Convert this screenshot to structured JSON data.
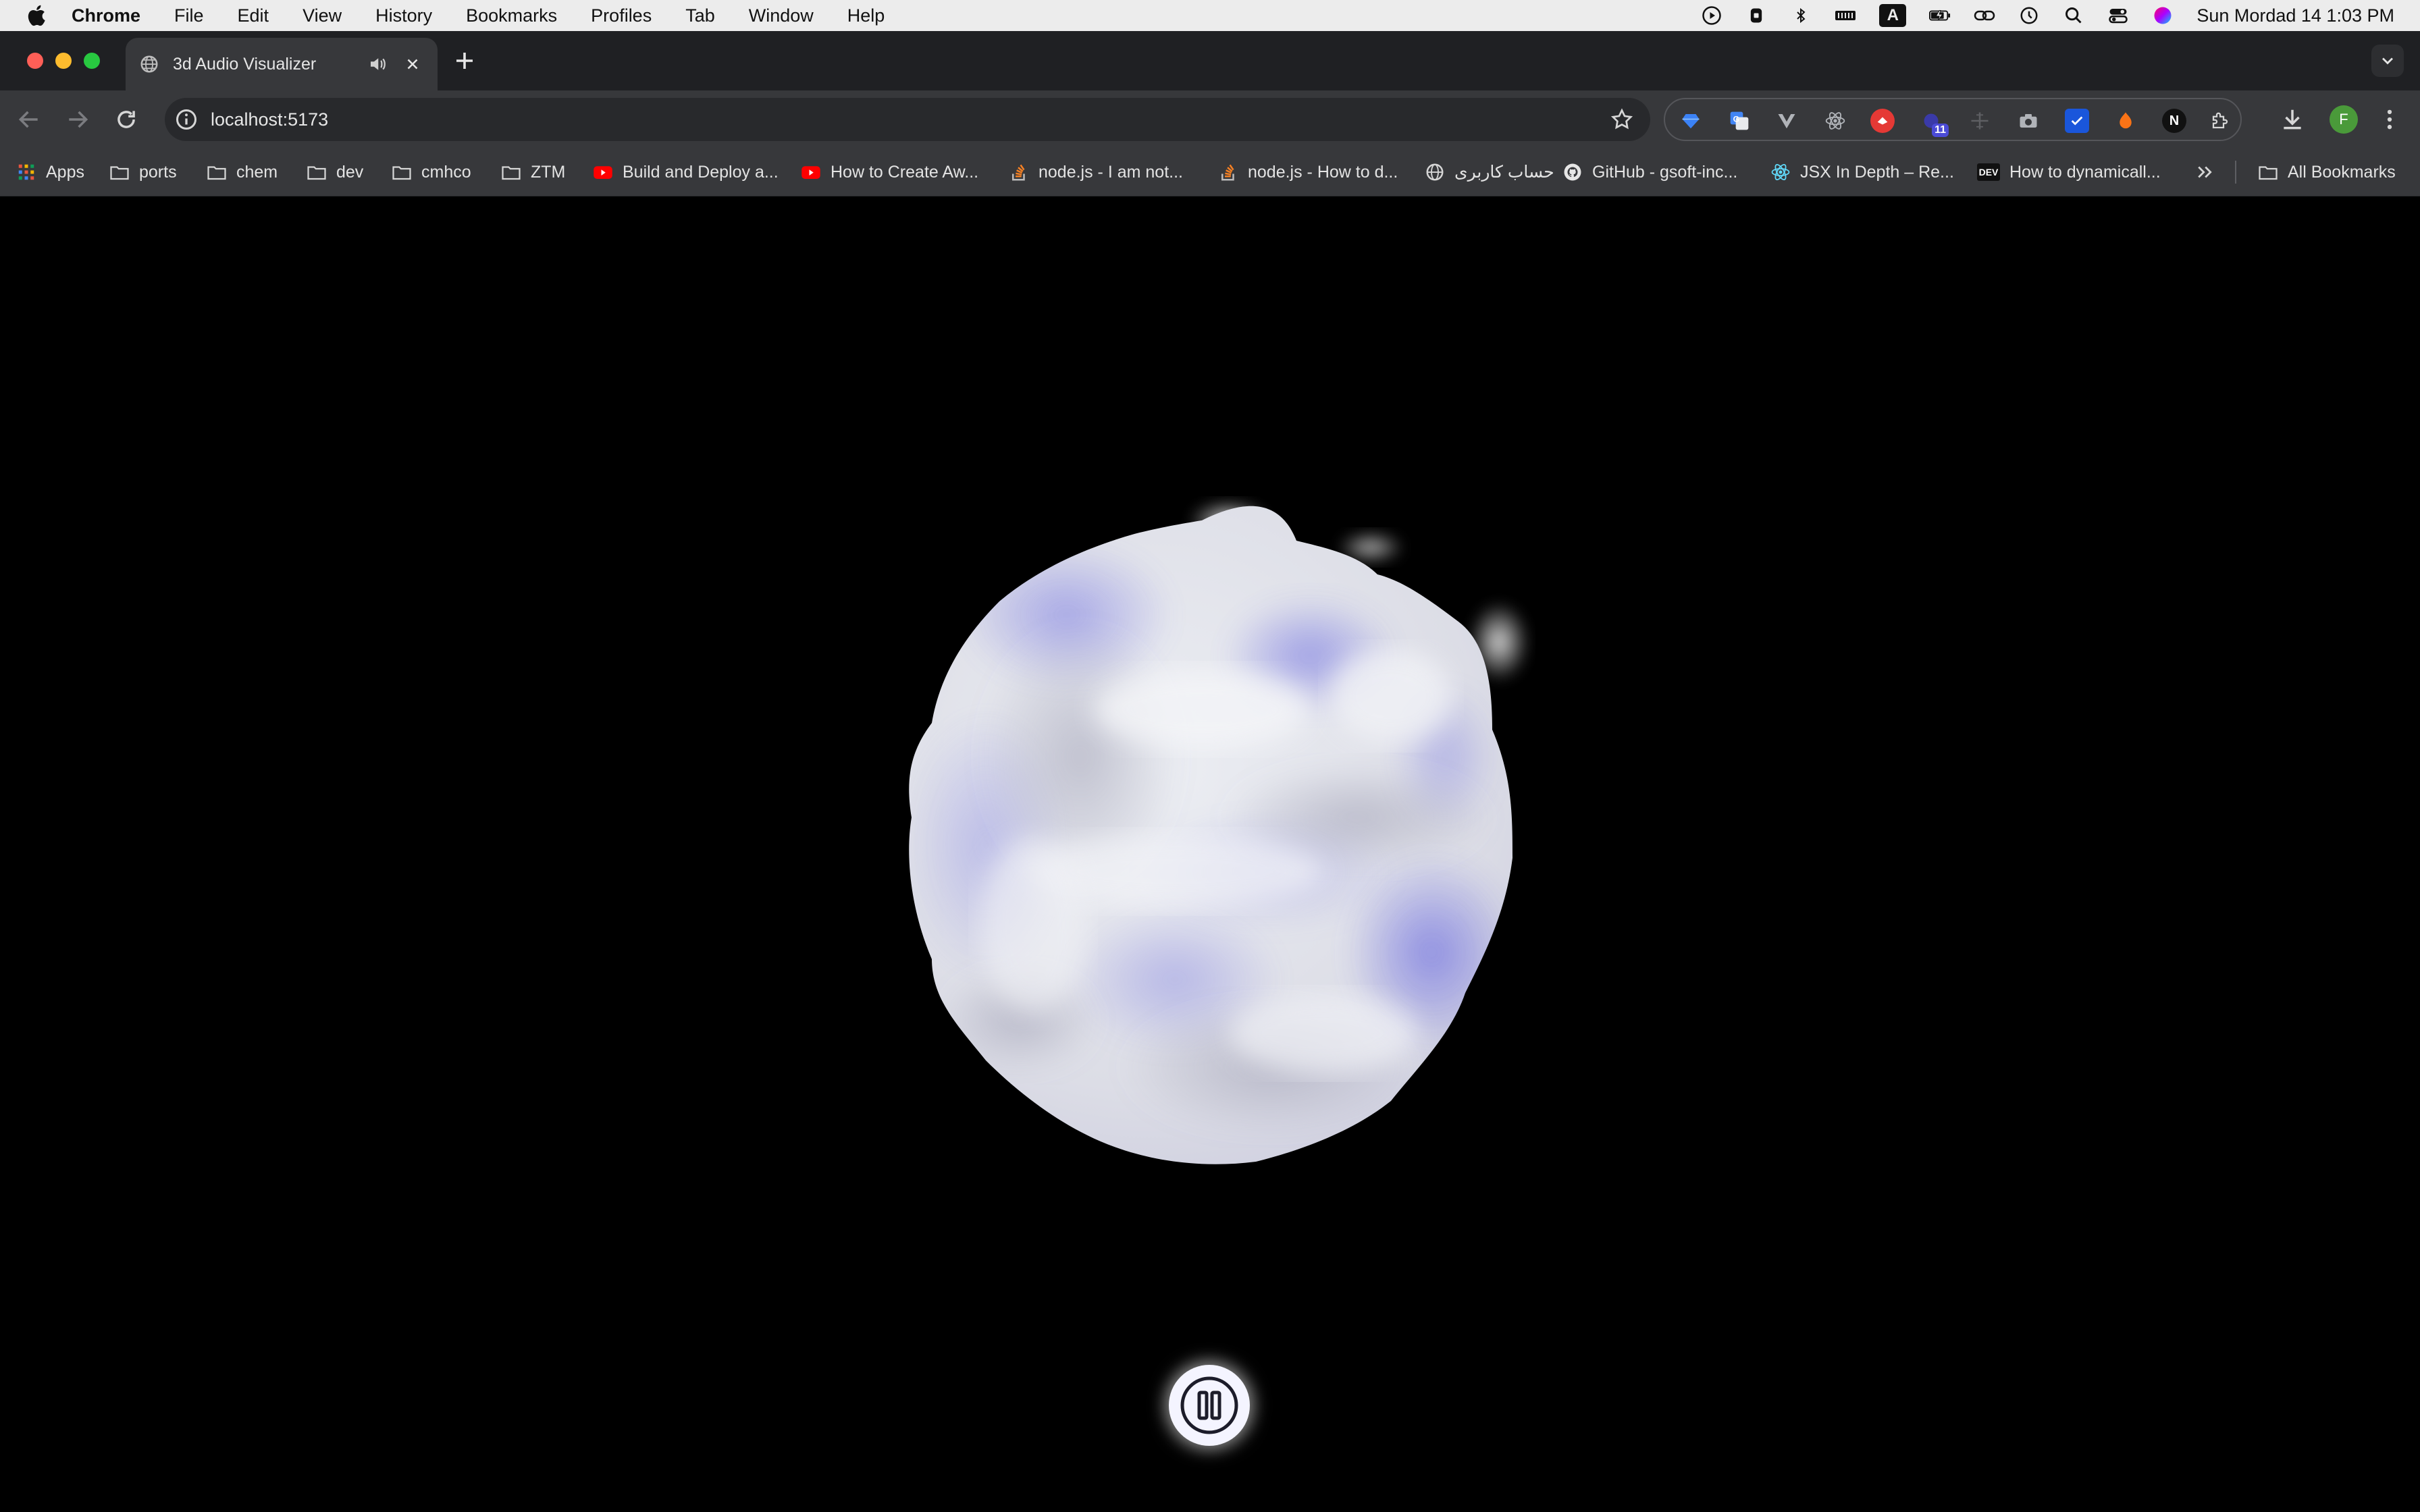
{
  "menubar": {
    "app_name": "Chrome",
    "items": [
      "File",
      "Edit",
      "View",
      "History",
      "Bookmarks",
      "Profiles",
      "Tab",
      "Window",
      "Help"
    ],
    "clock": "Sun Mordad 14  1:03 PM",
    "status_icons": [
      "play-circle-icon",
      "lock-icon",
      "bluetooth-icon",
      "battery-bars-icon",
      "input-source-icon",
      "battery-charging-icon",
      "link-icon",
      "clock-icon",
      "search-icon",
      "control-center-icon",
      "siri-icon"
    ],
    "input_source_label": "A"
  },
  "tab": {
    "title": "3d Audio Visualizer",
    "favicon": "globe-icon",
    "audio_icon": "speaker-icon",
    "close_icon": "close-icon"
  },
  "address_bar": {
    "url": "localhost:5173"
  },
  "extensions": {
    "badge_count": "11",
    "notion_letter": "N"
  },
  "profile": {
    "initial": "F",
    "color": "#4a9a3a"
  },
  "bookmarks": {
    "items": [
      {
        "label": "Apps",
        "icon": "apps-grid-icon"
      },
      {
        "label": "ports",
        "icon": "folder-icon"
      },
      {
        "label": "chem",
        "icon": "folder-icon"
      },
      {
        "label": "dev",
        "icon": "folder-icon"
      },
      {
        "label": "cmhco",
        "icon": "folder-icon"
      },
      {
        "label": "ZTM",
        "icon": "folder-icon"
      },
      {
        "label": "Build and Deploy a...",
        "icon": "youtube-icon"
      },
      {
        "label": "How to Create Aw...",
        "icon": "youtube-icon"
      },
      {
        "label": "node.js - I am not...",
        "icon": "stackoverflow-icon"
      },
      {
        "label": "node.js - How to d...",
        "icon": "stackoverflow-icon"
      },
      {
        "label": "حساب کاربری",
        "icon": "globe-icon"
      },
      {
        "label": "GitHub - gsoft-inc...",
        "icon": "github-icon"
      },
      {
        "label": "JSX In Depth – Re...",
        "icon": "react-icon"
      },
      {
        "label": "How to dynamicall...",
        "icon": "dev-icon"
      }
    ],
    "dev_badge": "DEV",
    "overflow_icon": "chevron-double-right-icon",
    "all_bookmarks": "All Bookmarks"
  },
  "visualizer": {
    "background": "#000000",
    "blob_color": "#e2e2ee",
    "blob_accent": "#7b7be0",
    "control_state": "playing",
    "control_icon": "pause-icon"
  }
}
